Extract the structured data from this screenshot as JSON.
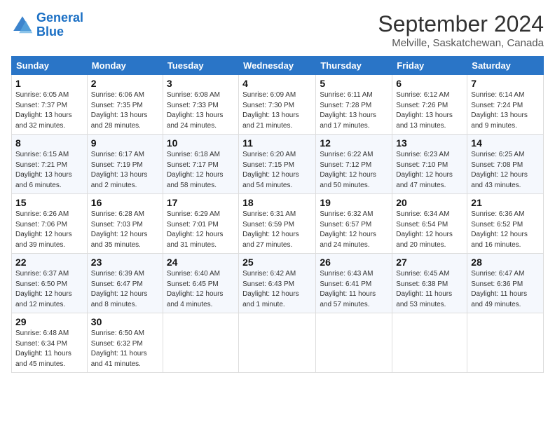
{
  "logo": {
    "line1": "General",
    "line2": "Blue"
  },
  "title": "September 2024",
  "location": "Melville, Saskatchewan, Canada",
  "days_of_week": [
    "Sunday",
    "Monday",
    "Tuesday",
    "Wednesday",
    "Thursday",
    "Friday",
    "Saturday"
  ],
  "weeks": [
    [
      {
        "day": "1",
        "info": "Sunrise: 6:05 AM\nSunset: 7:37 PM\nDaylight: 13 hours\nand 32 minutes."
      },
      {
        "day": "2",
        "info": "Sunrise: 6:06 AM\nSunset: 7:35 PM\nDaylight: 13 hours\nand 28 minutes."
      },
      {
        "day": "3",
        "info": "Sunrise: 6:08 AM\nSunset: 7:33 PM\nDaylight: 13 hours\nand 24 minutes."
      },
      {
        "day": "4",
        "info": "Sunrise: 6:09 AM\nSunset: 7:30 PM\nDaylight: 13 hours\nand 21 minutes."
      },
      {
        "day": "5",
        "info": "Sunrise: 6:11 AM\nSunset: 7:28 PM\nDaylight: 13 hours\nand 17 minutes."
      },
      {
        "day": "6",
        "info": "Sunrise: 6:12 AM\nSunset: 7:26 PM\nDaylight: 13 hours\nand 13 minutes."
      },
      {
        "day": "7",
        "info": "Sunrise: 6:14 AM\nSunset: 7:24 PM\nDaylight: 13 hours\nand 9 minutes."
      }
    ],
    [
      {
        "day": "8",
        "info": "Sunrise: 6:15 AM\nSunset: 7:21 PM\nDaylight: 13 hours\nand 6 minutes."
      },
      {
        "day": "9",
        "info": "Sunrise: 6:17 AM\nSunset: 7:19 PM\nDaylight: 13 hours\nand 2 minutes."
      },
      {
        "day": "10",
        "info": "Sunrise: 6:18 AM\nSunset: 7:17 PM\nDaylight: 12 hours\nand 58 minutes."
      },
      {
        "day": "11",
        "info": "Sunrise: 6:20 AM\nSunset: 7:15 PM\nDaylight: 12 hours\nand 54 minutes."
      },
      {
        "day": "12",
        "info": "Sunrise: 6:22 AM\nSunset: 7:12 PM\nDaylight: 12 hours\nand 50 minutes."
      },
      {
        "day": "13",
        "info": "Sunrise: 6:23 AM\nSunset: 7:10 PM\nDaylight: 12 hours\nand 47 minutes."
      },
      {
        "day": "14",
        "info": "Sunrise: 6:25 AM\nSunset: 7:08 PM\nDaylight: 12 hours\nand 43 minutes."
      }
    ],
    [
      {
        "day": "15",
        "info": "Sunrise: 6:26 AM\nSunset: 7:06 PM\nDaylight: 12 hours\nand 39 minutes."
      },
      {
        "day": "16",
        "info": "Sunrise: 6:28 AM\nSunset: 7:03 PM\nDaylight: 12 hours\nand 35 minutes."
      },
      {
        "day": "17",
        "info": "Sunrise: 6:29 AM\nSunset: 7:01 PM\nDaylight: 12 hours\nand 31 minutes."
      },
      {
        "day": "18",
        "info": "Sunrise: 6:31 AM\nSunset: 6:59 PM\nDaylight: 12 hours\nand 27 minutes."
      },
      {
        "day": "19",
        "info": "Sunrise: 6:32 AM\nSunset: 6:57 PM\nDaylight: 12 hours\nand 24 minutes."
      },
      {
        "day": "20",
        "info": "Sunrise: 6:34 AM\nSunset: 6:54 PM\nDaylight: 12 hours\nand 20 minutes."
      },
      {
        "day": "21",
        "info": "Sunrise: 6:36 AM\nSunset: 6:52 PM\nDaylight: 12 hours\nand 16 minutes."
      }
    ],
    [
      {
        "day": "22",
        "info": "Sunrise: 6:37 AM\nSunset: 6:50 PM\nDaylight: 12 hours\nand 12 minutes."
      },
      {
        "day": "23",
        "info": "Sunrise: 6:39 AM\nSunset: 6:47 PM\nDaylight: 12 hours\nand 8 minutes."
      },
      {
        "day": "24",
        "info": "Sunrise: 6:40 AM\nSunset: 6:45 PM\nDaylight: 12 hours\nand 4 minutes."
      },
      {
        "day": "25",
        "info": "Sunrise: 6:42 AM\nSunset: 6:43 PM\nDaylight: 12 hours\nand 1 minute."
      },
      {
        "day": "26",
        "info": "Sunrise: 6:43 AM\nSunset: 6:41 PM\nDaylight: 11 hours\nand 57 minutes."
      },
      {
        "day": "27",
        "info": "Sunrise: 6:45 AM\nSunset: 6:38 PM\nDaylight: 11 hours\nand 53 minutes."
      },
      {
        "day": "28",
        "info": "Sunrise: 6:47 AM\nSunset: 6:36 PM\nDaylight: 11 hours\nand 49 minutes."
      }
    ],
    [
      {
        "day": "29",
        "info": "Sunrise: 6:48 AM\nSunset: 6:34 PM\nDaylight: 11 hours\nand 45 minutes."
      },
      {
        "day": "30",
        "info": "Sunrise: 6:50 AM\nSunset: 6:32 PM\nDaylight: 11 hours\nand 41 minutes."
      },
      {
        "day": "",
        "info": ""
      },
      {
        "day": "",
        "info": ""
      },
      {
        "day": "",
        "info": ""
      },
      {
        "day": "",
        "info": ""
      },
      {
        "day": "",
        "info": ""
      }
    ]
  ]
}
